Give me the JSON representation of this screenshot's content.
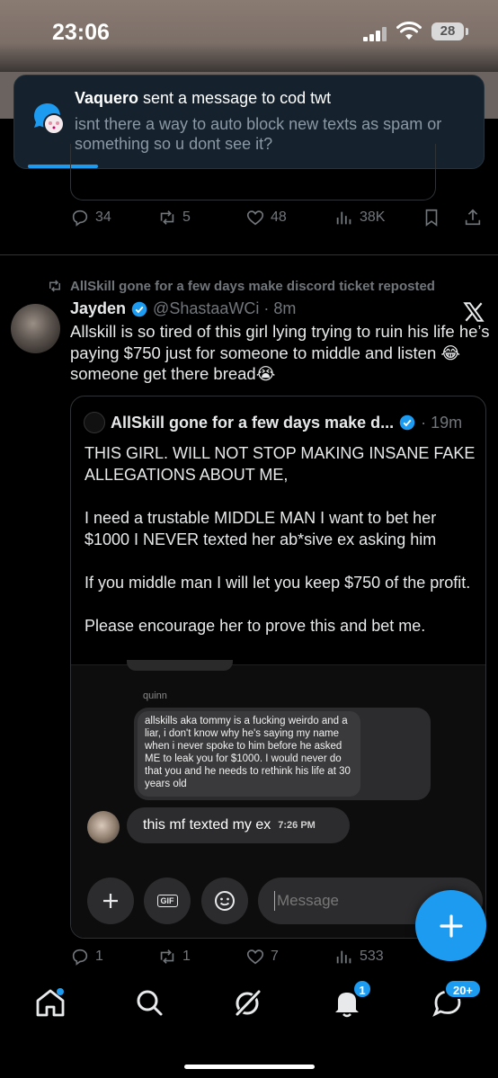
{
  "status_bar": {
    "time": "23:06",
    "battery": "28"
  },
  "notification": {
    "sender": "Vaquero",
    "title_suffix": " sent a message to cod twt",
    "text": "isnt there a way to auto block new texts as spam or something so u dont see it?"
  },
  "previous_tweet_actions": {
    "replies": "34",
    "reposts": "5",
    "likes": "48",
    "views": "38K"
  },
  "tweet": {
    "reposted_by": "AllSkill gone for a few days make discord ticket reposted",
    "author_name": "Jayden",
    "author_handle": "@ShastaaWCi · 8m",
    "text": "Allskill is so tired of this girl lying trying to ruin his life he’s paying $750 just for someone to middle and listen 😂 someone get there bread😭",
    "quote": {
      "author_name": "AllSkill gone for a few days make d...",
      "time": "· 19m",
      "paragraphs": [
        "THIS GIRL. WILL NOT STOP MAKING INSANE FAKE ALLEGATIONS ABOUT ME,",
        "I need a trustable MIDDLE MAN I want to bet her $1000 I NEVER texted her ab*sive ex asking him",
        "If you middle man I will let you keep $750 of the profit.",
        "Please encourage her to prove this and bet me."
      ],
      "screenshot": {
        "sender_label": "quinn",
        "quoted_message": "allskills aka tommy is a fucking weirdo and a liar, i don't know why he's saying my name when i never spoke to him before he asked ME to leak you for $1000. I would never do that you and he needs to rethink his life at 30 years old",
        "reply_text": "this mf texted my ex",
        "reply_time": "7:26 PM",
        "message_placeholder": "Message",
        "gif_label": "GIF"
      }
    },
    "actions": {
      "replies": "1",
      "reposts": "1",
      "likes": "7",
      "views": "533"
    }
  },
  "nav": {
    "notifications_badge": "1",
    "messages_badge": "20+"
  },
  "colors": {
    "accent": "#1d9bf0",
    "background": "#000000",
    "muted": "#71767b"
  }
}
